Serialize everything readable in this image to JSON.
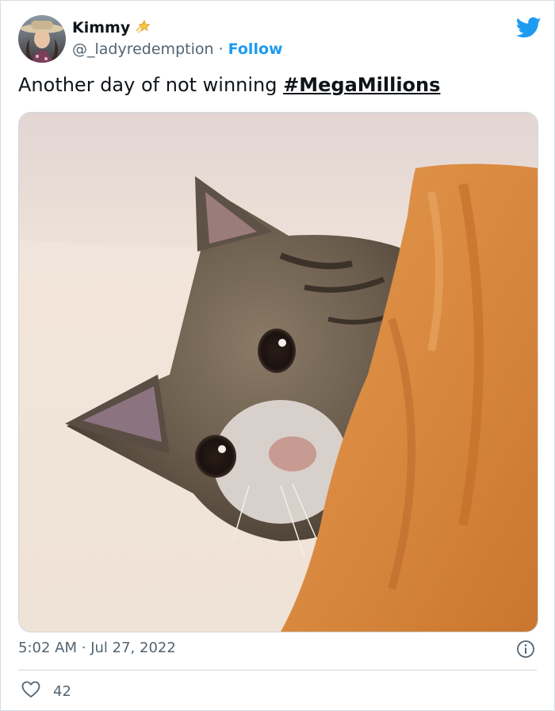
{
  "author": {
    "name": "Kimmy",
    "handle": "@_ladyredemption",
    "separator": "·",
    "follow_label": "Follow"
  },
  "tweet": {
    "text_prefix": "Another day of not winning ",
    "hashtag": "#MegaMillions"
  },
  "meta": {
    "time": "5:02 AM",
    "separator": "·",
    "date": "Jul 27, 2022"
  },
  "engagement": {
    "likes": "42"
  },
  "colors": {
    "brand_blue": "#1d9bf0",
    "secondary_text": "#536471",
    "primary_text": "#0f1419"
  },
  "icons": {
    "platform": "twitter-bird-icon",
    "badge": "star-emoji-icon",
    "info": "info-circle-icon",
    "like": "heart-outline-icon"
  }
}
